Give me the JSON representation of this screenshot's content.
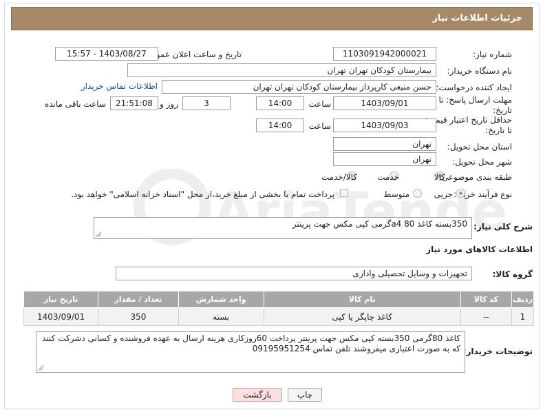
{
  "header": {
    "title": "جزئیات اطلاعات نیاز"
  },
  "fields": {
    "need_number_label": "شماره نیاز:",
    "need_number": "1103091942000021",
    "announce_label": "تاریخ و ساعت اعلان عمومی:",
    "announce_value": "1403/08/27 - 15:57",
    "buyer_org_label": "نام دستگاه خریدار:",
    "buyer_org": "بیمارستان کودکان تهران تهران",
    "creator_label": "ایجاد کننده درخواست:",
    "creator": "حسن منیعی کارپرداز بیمارستان کودکان تهران تهران",
    "buyer_contact_link": "اطلاعات تماس خریدار",
    "reply_deadline_label": "مهلت ارسال پاسخ: تا تاریخ:",
    "reply_date": "1403/09/01",
    "time_label": "ساعت",
    "reply_time": "14:00",
    "days_value": "3",
    "days_label": "روز و",
    "remaining_time": "21:51:08",
    "remaining_label": "ساعت باقی مانده",
    "price_validity_label": "حداقل تاریخ اعتبار قیمت: تا تاریخ:",
    "price_date": "1403/09/03",
    "price_time": "14:00",
    "province_label": "استان محل تحویل:",
    "province": "تهران",
    "city_label": "شهر محل تحویل:",
    "city": "تهران",
    "category_label": "طبقه بندی موضوعی:",
    "category_options": [
      "کالا",
      "خدمت",
      "کالا/خدمت"
    ],
    "category_selected": "کالا",
    "process_label": "نوع فرآیند خرید :",
    "process_options": [
      "جزیی",
      "متوسط"
    ],
    "process_selected": "جزیی",
    "treasury_note": "پرداخت تمام یا بخشی از مبلغ خرید،از محل \"اسناد خزانه اسلامی\" خواهد بود."
  },
  "description": {
    "label": "شرح کلی نیاز:",
    "text": "350بسته کاغذ 80 a4گرمی کپی مکس جهت پرینتر"
  },
  "goods_info": {
    "title": "اطلاعات کالاهای مورد نیاز",
    "group_label": "گروه کالا:",
    "group_value": "تجهیزات و وسایل تحصیلی واداری"
  },
  "table": {
    "headers": [
      "ردیف",
      "کد کالا",
      "نام کالا",
      "واحد شمارش",
      "تعداد / مقدار",
      "تاریخ نیاز"
    ],
    "rows": [
      [
        "1",
        "--",
        "کاغذ چاپگر یا کپی",
        "بسته",
        "350",
        "1403/09/01"
      ]
    ]
  },
  "buyer_notes": {
    "label": "توضیحات خریدار:",
    "text": "کاغذ 80گرمی 350بسته کپی مکس جهت پرینتر پرداخت 60روزکاری هزینه ارسال به عهده فروشنده و کسانی دشرکت کنند که به صورت اعتباری میفروشند تلفن تماس 09195951254"
  },
  "buttons": {
    "print": "چاپ",
    "back": "بازگشت"
  },
  "watermark_text": "AriaTender.neT",
  "colors": {
    "header_bg": "#a68a68",
    "table_header_bg": "#a7a7a7",
    "link": "#1a4fa3"
  }
}
